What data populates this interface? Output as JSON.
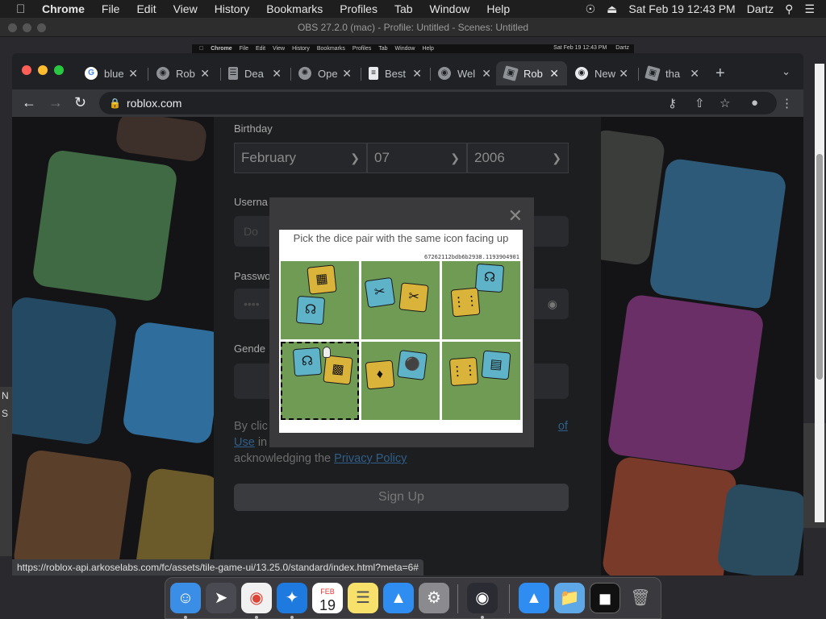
{
  "menubar": {
    "app_name": "Chrome",
    "items": [
      "File",
      "Edit",
      "View",
      "History",
      "Bookmarks",
      "Profiles",
      "Tab",
      "Window",
      "Help"
    ],
    "datetime": "Sat Feb 19  12:43 PM",
    "user": "Dartz"
  },
  "obs": {
    "title": "OBS 27.2.0 (mac) - Profile: Untitled - Scenes: Untitled",
    "left_strip": [
      "N",
      "S"
    ]
  },
  "inner_menubar": {
    "app_name": "Chrome",
    "items": [
      "File",
      "Edit",
      "View",
      "History",
      "Bookmarks",
      "Profiles",
      "Tab",
      "Window",
      "Help"
    ],
    "datetime": "Sat Feb 19  12:43 PM",
    "user": "Dartz"
  },
  "tabs": [
    {
      "label": "blue",
      "icon": "google-icon",
      "active": false
    },
    {
      "label": "Rob",
      "icon": "globe-icon",
      "active": false
    },
    {
      "label": "Dea",
      "icon": "doc-icon",
      "active": false
    },
    {
      "label": "Ope",
      "icon": "openai-icon",
      "active": false
    },
    {
      "label": "Best",
      "icon": "doc-icon",
      "active": false
    },
    {
      "label": "Wel",
      "icon": "globe-icon",
      "active": false
    },
    {
      "label": "Rob",
      "icon": "roblox-icon",
      "active": true
    },
    {
      "label": "New",
      "icon": "chrome-icon",
      "active": false
    },
    {
      "label": "tha",
      "icon": "roblox-icon",
      "active": false
    }
  ],
  "address_bar": {
    "url": "roblox.com"
  },
  "form": {
    "birthday_label": "Birthday",
    "month": "February",
    "day": "07",
    "year": "2006",
    "username_label": "Userna",
    "username_placeholder": "Do",
    "password_label": "Passwo",
    "password_placeholder": "••••",
    "gender_label": "Gende",
    "terms_prefix": "By clic",
    "terms_link1_tail": "of",
    "terms_link1_line2": "Use",
    "terms_middle": " in",
    "terms_line3": "acknowledging the ",
    "privacy_link": "Privacy Policy",
    "signup_label": "Sign Up"
  },
  "captcha": {
    "instruction": "Pick the dice pair with the same icon facing up",
    "id": "67262112bdb6b2938.1193904901",
    "selected_index": 3
  },
  "status_url": "https://roblox-api.arkoselabs.com/fc/assets/tile-game-ui/13.25.0/standard/index.html?meta=6#",
  "dock": {
    "calendar_month": "FEB",
    "calendar_day": "19"
  },
  "colors": {
    "roblox_bg": "#141416",
    "chrome_dark": "#202124",
    "link": "#2f5f8a",
    "captcha_grass": "#6f9b55"
  }
}
